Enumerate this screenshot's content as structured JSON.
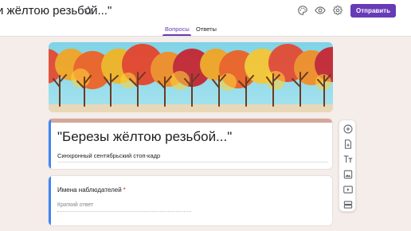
{
  "header": {
    "title": "и жёлтою резьбой...\"",
    "send_label": "Отправить",
    "icons": [
      "star-icon",
      "palette-icon",
      "preview-eye-icon",
      "settings-gear-icon"
    ]
  },
  "tabs": [
    {
      "label": "Вопросы",
      "active": true
    },
    {
      "label": "Ответы",
      "active": false
    }
  ],
  "form": {
    "title": "\"Березы жёлтою резьбой...\"",
    "description": "Синхронный сентябрьский стоп-кадр"
  },
  "question": {
    "label": "Имена наблюдателей",
    "required_mark": "*",
    "placeholder": "Краткий ответ"
  },
  "side_toolbar": {
    "items": [
      "add-question-icon",
      "import-questions-icon",
      "add-title-icon",
      "add-image-icon",
      "add-video-icon",
      "add-section-icon"
    ]
  },
  "colors": {
    "accent": "#673ab7",
    "card_accent": "#4285f4",
    "background": "#f4ede9",
    "required": "#d93025"
  }
}
